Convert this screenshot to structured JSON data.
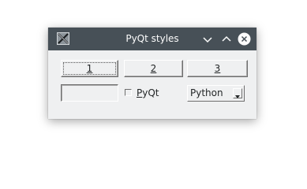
{
  "window": {
    "title": "PyQt styles",
    "app_icon": "x11-app-icon",
    "controls": [
      "minimize-icon",
      "maximize-icon",
      "close-icon"
    ]
  },
  "buttons": [
    {
      "label": "1"
    },
    {
      "label": "2"
    },
    {
      "label": "3"
    }
  ],
  "line_edit": {
    "value": ""
  },
  "checkbox": {
    "label_mnemonic": "P",
    "label_rest": "yQt",
    "checked": false
  },
  "combo": {
    "selected": "Python"
  },
  "colors": {
    "titlebar": "#475057",
    "window_bg": "#eff0f1",
    "text": "#232627"
  }
}
